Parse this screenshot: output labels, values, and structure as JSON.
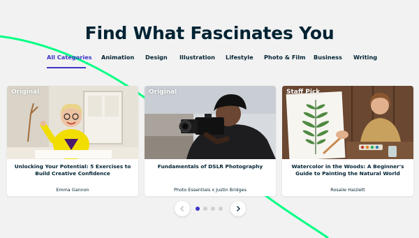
{
  "headline": "Find What Fascinates You",
  "tabs": [
    {
      "label": "All Categories"
    },
    {
      "label": "Animation"
    },
    {
      "label": "Design"
    },
    {
      "label": "Illustration"
    },
    {
      "label": "Lifestyle"
    },
    {
      "label": "Photo & Film"
    },
    {
      "label": "Business"
    },
    {
      "label": "Writing"
    }
  ],
  "cards": [
    {
      "badge": "Original",
      "title": "Unlocking Your Potential: 5 Exercises to Build Creative Confidence",
      "author": "Emma Gannon"
    },
    {
      "badge": "Original",
      "title": "Fundamentals of DSLR Photography",
      "author": "Photo Essentials x Justin Bridges"
    },
    {
      "badge": "Staff Pick.",
      "title": "Watercolor in the Woods: A Beginner's Guide to Painting the Natural World",
      "author": "Rosalie Haizlett"
    }
  ],
  "carousel": {
    "current_page": 1,
    "total_pages": 4
  },
  "colors": {
    "accent": "#3d35c7",
    "decor_line": "#00ff84",
    "text": "#002333",
    "background": "#f2f2f2"
  }
}
